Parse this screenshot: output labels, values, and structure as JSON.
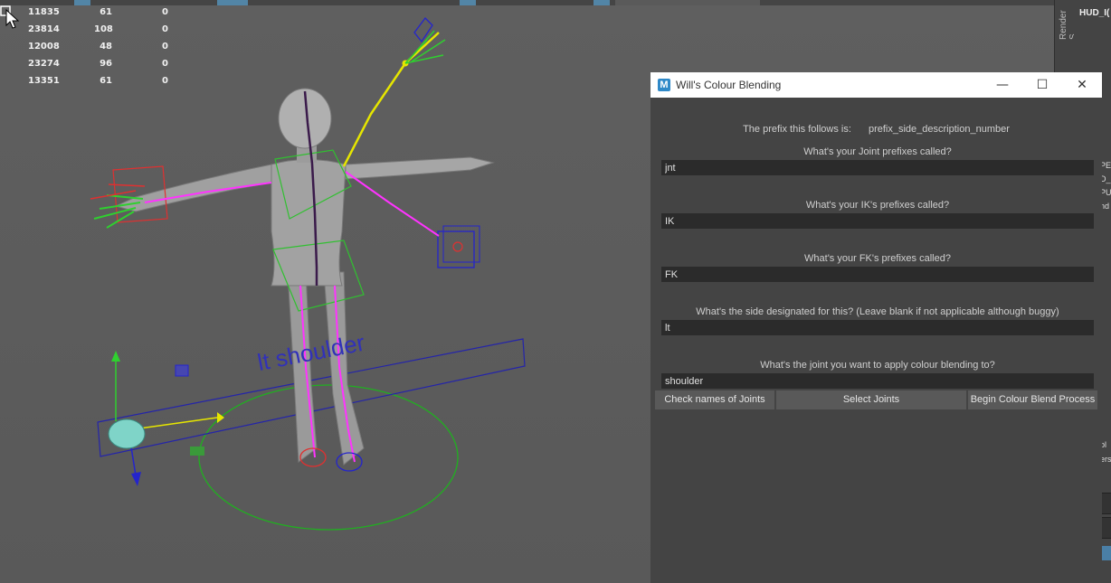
{
  "viewport": {
    "hud_rows": [
      {
        "id": "11835",
        "c2": "61",
        "c3": "0"
      },
      {
        "id": "23814",
        "c2": "108",
        "c3": "0"
      },
      {
        "id": "12008",
        "c2": "48",
        "c3": "0"
      },
      {
        "id": "23274",
        "c2": "96",
        "c3": "0"
      },
      {
        "id": "13351",
        "c2": "61",
        "c3": "0"
      }
    ],
    "annotation_text": "lt shoulder",
    "colors": {
      "ik": "#2fd02f",
      "fk": "#e03030",
      "spine": "#ff33ff",
      "ctrl": "#2b2bcc",
      "selected": "#e6e600",
      "ground": "#20b020"
    }
  },
  "right_panel": {
    "render_setup_label": "Render S",
    "hud_label": "HUD_I(",
    "fragments": [
      "PE",
      "D_",
      "PU",
      "nd",
      "pl",
      "ers"
    ]
  },
  "dialog": {
    "app_icon": "maya-logo-icon",
    "title": "Will's Colour Blending",
    "minimize": "—",
    "maximize": "☐",
    "close": "✕",
    "prefix_text": "The prefix this follows is:",
    "prefix_value": "prefix_side_description_number",
    "fields": [
      {
        "label": "What's your Joint prefixes called?",
        "value": "jnt"
      },
      {
        "label": "What's your IK's prefixes called?",
        "value": "IK"
      },
      {
        "label": "What's your FK's prefixes called?",
        "value": "FK"
      },
      {
        "label": "What's the side designated for this? (Leave blank if not applicable although buggy)",
        "value": "lt"
      },
      {
        "label": "What's the joint you want to apply colour blending to?",
        "value": "shoulder"
      }
    ],
    "buttons": {
      "check": "Check names of Joints",
      "select": "Select Joints",
      "begin": "Begin Colour Blend Process"
    }
  }
}
